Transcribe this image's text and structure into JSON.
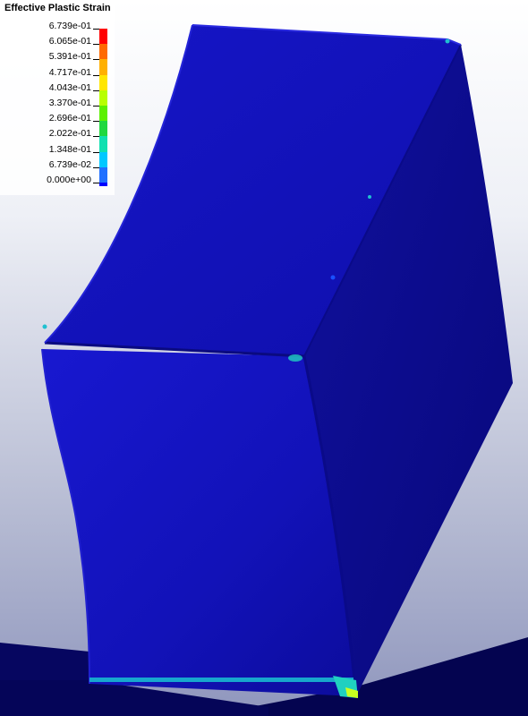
{
  "legend": {
    "title": "Effective Plastic Strain",
    "labels": [
      "6.739e-01",
      "6.065e-01",
      "5.391e-01",
      "4.717e-01",
      "4.043e-01",
      "3.370e-01",
      "2.696e-01",
      "2.022e-01",
      "1.348e-01",
      "6.739e-02",
      "0.000e+00"
    ],
    "colors": [
      "#ff0000",
      "#ff6a00",
      "#ffb000",
      "#ffe600",
      "#b8ff00",
      "#5cf000",
      "#20d840",
      "#10e0b0",
      "#00c8ff",
      "#2070ff",
      "#0000ff"
    ]
  },
  "colors": {
    "model_front": "#1414c8",
    "model_side": "#0d0d9a",
    "model_top": "#1212b4",
    "shadow": "#050550",
    "hotspot_cyan": "#20d0c0",
    "hotspot_yellow": "#c8ff20"
  }
}
